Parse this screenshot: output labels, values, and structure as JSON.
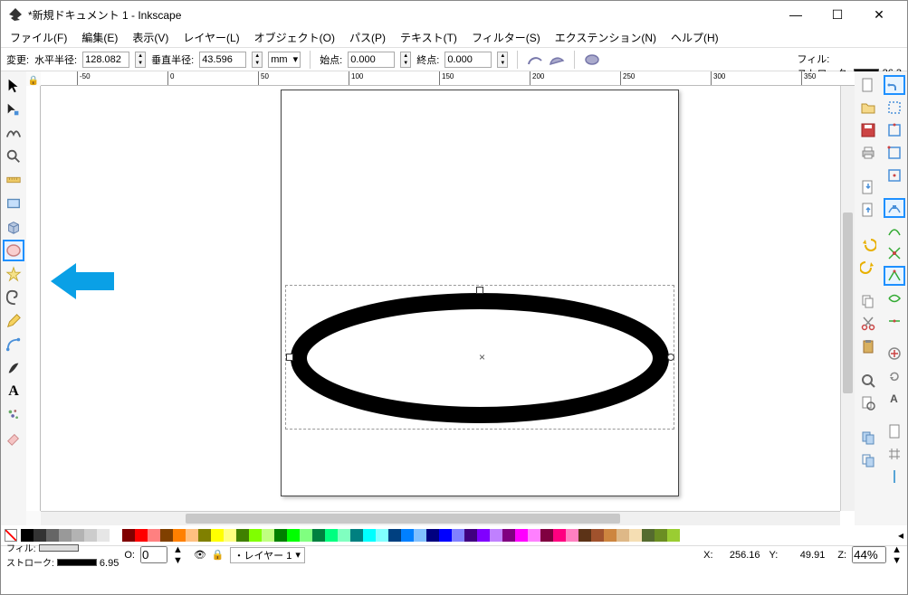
{
  "window": {
    "title": "*新規ドキュメント 1 - Inkscape",
    "min": "—",
    "max": "☐",
    "close": "✕"
  },
  "menu": {
    "file": "ファイル(F)",
    "edit": "編集(E)",
    "view": "表示(V)",
    "layer": "レイヤー(L)",
    "object": "オブジェクト(O)",
    "path": "パス(P)",
    "text": "テキスト(T)",
    "filter": "フィルター(S)",
    "extension": "エクステンション(N)",
    "help": "ヘルプ(H)"
  },
  "opts": {
    "change": "変更:",
    "rx_label": "水平半径:",
    "rx": "128.082",
    "ry_label": "垂直半径:",
    "ry": "43.596",
    "unit": "mm",
    "start_label": "始点:",
    "start": "0.000",
    "end_label": "終点:",
    "end": "0.000"
  },
  "swatch_info": {
    "fill_label": "フィル:",
    "stroke_label": "ストローク:",
    "stroke_w": "26.3"
  },
  "status": {
    "fill_label": "フィル:",
    "stroke_label": "ストローク:",
    "stroke_w": "6.95",
    "opacity_label": "O:",
    "opacity": "0",
    "layer_prefix": "・レイヤー 1",
    "x_label": "X:",
    "x": "256.16",
    "y_label": "Y:",
    "y": "49.91",
    "zoom_label": "Z:",
    "zoom": "44%"
  },
  "icons": {
    "lock": "🔒",
    "eye": "👁",
    "layer": "◧"
  },
  "ruler_ticks": [
    "-50",
    "0",
    "50",
    "100",
    "150",
    "200",
    "250",
    "300",
    "350"
  ]
}
